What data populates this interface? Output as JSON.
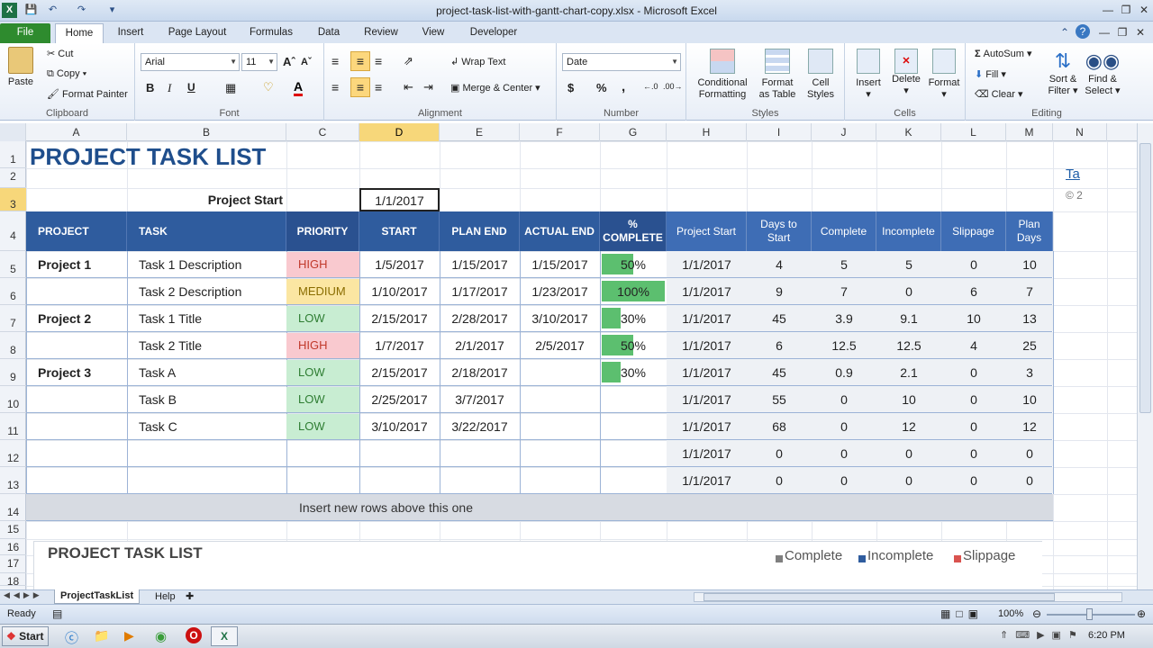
{
  "window": {
    "title": "project-task-list-with-gantt-chart-copy.xlsx  -  Microsoft Excel"
  },
  "ribbon_tabs": [
    "File",
    "Home",
    "Insert",
    "Page Layout",
    "Formulas",
    "Data",
    "Review",
    "View",
    "Developer"
  ],
  "clipboard": {
    "paste": "Paste",
    "cut": "Cut",
    "copy": "Copy",
    "format_painter": "Format Painter",
    "label": "Clipboard"
  },
  "font": {
    "name": "Arial",
    "size": "11",
    "bold": "B",
    "italic": "I",
    "underline": "U",
    "label": "Font"
  },
  "alignment": {
    "wrap": "Wrap Text",
    "merge": "Merge & Center",
    "label": "Alignment"
  },
  "number": {
    "format": "Date",
    "currency": "$",
    "percent": "%",
    "comma": ",",
    "label": "Number"
  },
  "styles": {
    "conditional": "Conditional",
    "conditional2": "Formatting",
    "format_table": "Format",
    "format_table2": "as Table",
    "cell_styles": "Cell",
    "cell_styles2": "Styles",
    "label": "Styles"
  },
  "cells": {
    "insert": "Insert",
    "delete": "Delete",
    "format": "Format",
    "label": "Cells"
  },
  "editing": {
    "autosum": "AutoSum",
    "fill": "Fill",
    "clear": "Clear",
    "sort": "Sort &",
    "sort2": "Filter",
    "find": "Find &",
    "find2": "Select",
    "label": "Editing"
  },
  "columns": [
    "A",
    "B",
    "C",
    "D",
    "E",
    "F",
    "G",
    "H",
    "I",
    "J",
    "K",
    "L",
    "M",
    "N"
  ],
  "rows": [
    "1",
    "2",
    "3",
    "4",
    "5",
    "6",
    "7",
    "8",
    "9",
    "10",
    "11",
    "12",
    "13",
    "14",
    "15",
    "16",
    "17",
    "18"
  ],
  "sheet": {
    "title": "PROJECT TASK LIST",
    "project_start_label": "Project Start",
    "project_start_value": "1/1/2017",
    "headers": [
      "PROJECT",
      "TASK",
      "PRIORITY",
      "START",
      "PLAN END",
      "ACTUAL END",
      "% COMPLETE",
      "Project Start",
      "Days to Start",
      "Complete",
      "Incomplete",
      "Slippage",
      "Plan Days"
    ],
    "tasks": [
      {
        "project": "Project 1",
        "task": "Task 1 Description",
        "priority": "HIGH",
        "start": "1/5/2017",
        "plan_end": "1/15/2017",
        "actual_end": "1/15/2017",
        "pct": "50%",
        "pct_val": 0.5,
        "ps": "1/1/2017",
        "dts": "4",
        "complete": "5",
        "incomplete": "5",
        "slip": "0",
        "plan_days": "10"
      },
      {
        "project": "",
        "task": "Task 2 Description",
        "priority": "MEDIUM",
        "start": "1/10/2017",
        "plan_end": "1/17/2017",
        "actual_end": "1/23/2017",
        "pct": "100%",
        "pct_val": 1.0,
        "ps": "1/1/2017",
        "dts": "9",
        "complete": "7",
        "incomplete": "0",
        "slip": "6",
        "plan_days": "7"
      },
      {
        "project": "Project 2",
        "task": "Task 1 Title",
        "priority": "LOW",
        "start": "2/15/2017",
        "plan_end": "2/28/2017",
        "actual_end": "3/10/2017",
        "pct": "30%",
        "pct_val": 0.3,
        "ps": "1/1/2017",
        "dts": "45",
        "complete": "3.9",
        "incomplete": "9.1",
        "slip": "10",
        "plan_days": "13"
      },
      {
        "project": "",
        "task": "Task 2 Title",
        "priority": "HIGH",
        "start": "1/7/2017",
        "plan_end": "2/1/2017",
        "actual_end": "2/5/2017",
        "pct": "50%",
        "pct_val": 0.5,
        "ps": "1/1/2017",
        "dts": "6",
        "complete": "12.5",
        "incomplete": "12.5",
        "slip": "4",
        "plan_days": "25"
      },
      {
        "project": "Project 3",
        "task": "Task A",
        "priority": "LOW",
        "start": "2/15/2017",
        "plan_end": "2/18/2017",
        "actual_end": "",
        "pct": "30%",
        "pct_val": 0.3,
        "ps": "1/1/2017",
        "dts": "45",
        "complete": "0.9",
        "incomplete": "2.1",
        "slip": "0",
        "plan_days": "3"
      },
      {
        "project": "",
        "task": "Task B",
        "priority": "LOW",
        "start": "2/25/2017",
        "plan_end": "3/7/2017",
        "actual_end": "",
        "pct": "",
        "pct_val": 0,
        "ps": "1/1/2017",
        "dts": "55",
        "complete": "0",
        "incomplete": "10",
        "slip": "0",
        "plan_days": "10"
      },
      {
        "project": "",
        "task": "Task C",
        "priority": "LOW",
        "start": "3/10/2017",
        "plan_end": "3/22/2017",
        "actual_end": "",
        "pct": "",
        "pct_val": 0,
        "ps": "1/1/2017",
        "dts": "68",
        "complete": "0",
        "incomplete": "12",
        "slip": "0",
        "plan_days": "12"
      },
      {
        "project": "",
        "task": "",
        "priority": "",
        "start": "",
        "plan_end": "",
        "actual_end": "",
        "pct": "",
        "pct_val": 0,
        "ps": "1/1/2017",
        "dts": "0",
        "complete": "0",
        "incomplete": "0",
        "slip": "0",
        "plan_days": "0"
      },
      {
        "project": "",
        "task": "",
        "priority": "",
        "start": "",
        "plan_end": "",
        "actual_end": "",
        "pct": "",
        "pct_val": 0,
        "ps": "1/1/2017",
        "dts": "0",
        "complete": "0",
        "incomplete": "0",
        "slip": "0",
        "plan_days": "0"
      }
    ],
    "insert_note": "Insert new rows above this one",
    "chart_title": "PROJECT TASK LIST",
    "legend": [
      "Complete",
      "Incomplete",
      "Slippage"
    ],
    "side_text": [
      "Ta",
      "© 2"
    ]
  },
  "colors": {
    "HIGH": "#f9c9cf",
    "MEDIUM": "#fbe6a2",
    "LOW": "#c8edd2",
    "HIGH_text": "#c0392b",
    "MEDIUM_text": "#8a6d00",
    "LOW_text": "#2e7d32",
    "header": "#2f5c9e",
    "title": "#1f4e8c"
  },
  "sheet_tabs": [
    "ProjectTaskList",
    "Help"
  ],
  "status": {
    "ready": "Ready",
    "zoom": "100%"
  },
  "taskbar": {
    "start": "Start",
    "time": "6:20 PM"
  }
}
